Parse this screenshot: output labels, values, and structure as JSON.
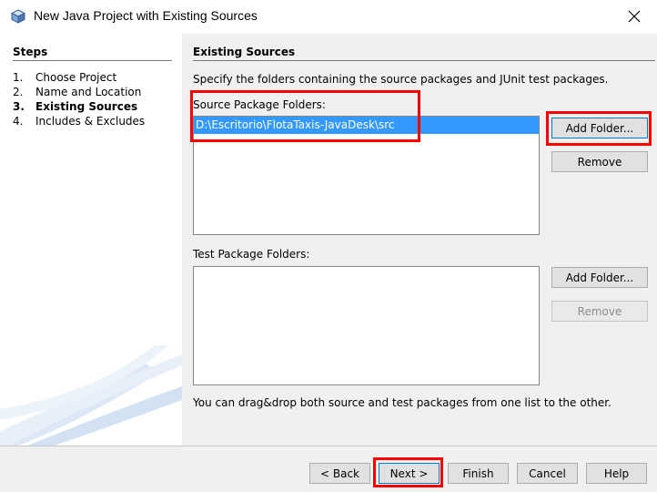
{
  "window": {
    "title": "New Java Project with Existing Sources",
    "icon": "java-cube-icon",
    "close_icon": "close-icon"
  },
  "steps": {
    "title": "Steps",
    "items": [
      {
        "num": "1.",
        "label": "Choose Project"
      },
      {
        "num": "2.",
        "label": "Name and Location"
      },
      {
        "num": "3.",
        "label": "Existing Sources"
      },
      {
        "num": "4.",
        "label": "Includes & Excludes"
      }
    ],
    "current_index": 2
  },
  "main": {
    "title": "Existing Sources",
    "instructions": "Specify the folders containing the source packages and JUnit test packages.",
    "source": {
      "label": "Source Package Folders:",
      "items": [
        "D:\\Escritorio\\FlotaTaxis-JavaDesk\\src"
      ],
      "add_label": "Add Folder...",
      "remove_label": "Remove"
    },
    "test": {
      "label": "Test Package Folders:",
      "items": [],
      "add_label": "Add Folder...",
      "remove_label": "Remove"
    },
    "note": "You can drag&drop both source and test packages from one list to the other."
  },
  "footer": {
    "back": "< Back",
    "next": "Next >",
    "finish": "Finish",
    "cancel": "Cancel",
    "help": "Help"
  },
  "colors": {
    "selection": "#3399ff",
    "highlight": "#ff0000"
  }
}
